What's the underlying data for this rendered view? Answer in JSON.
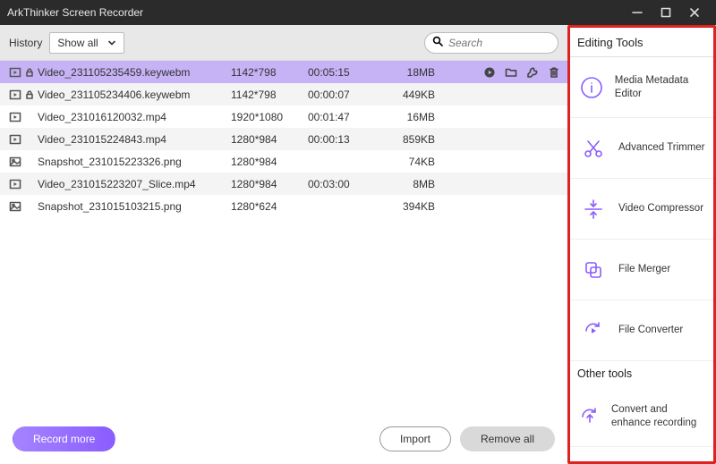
{
  "title": "ArkThinker Screen Recorder",
  "toolbar": {
    "history_label": "History",
    "filter_label": "Show all",
    "search_placeholder": "Search"
  },
  "files": [
    {
      "type": "video",
      "locked": true,
      "name": "Video_231105235459.keywebm",
      "resolution": "1142*798",
      "duration": "00:05:15",
      "size": "18MB",
      "selected": true
    },
    {
      "type": "video",
      "locked": true,
      "name": "Video_231105234406.keywebm",
      "resolution": "1142*798",
      "duration": "00:00:07",
      "size": "449KB",
      "selected": false
    },
    {
      "type": "video",
      "locked": false,
      "name": "Video_231016120032.mp4",
      "resolution": "1920*1080",
      "duration": "00:01:47",
      "size": "16MB",
      "selected": false
    },
    {
      "type": "video",
      "locked": false,
      "name": "Video_231015224843.mp4",
      "resolution": "1280*984",
      "duration": "00:00:13",
      "size": "859KB",
      "selected": false
    },
    {
      "type": "image",
      "locked": false,
      "name": "Snapshot_231015223326.png",
      "resolution": "1280*984",
      "duration": "",
      "size": "74KB",
      "selected": false
    },
    {
      "type": "video",
      "locked": false,
      "name": "Video_231015223207_Slice.mp4",
      "resolution": "1280*984",
      "duration": "00:03:00",
      "size": "8MB",
      "selected": false
    },
    {
      "type": "image",
      "locked": false,
      "name": "Snapshot_231015103215.png",
      "resolution": "1280*624",
      "duration": "",
      "size": "394KB",
      "selected": false
    }
  ],
  "footer": {
    "record_more": "Record more",
    "import": "Import",
    "remove_all": "Remove all"
  },
  "sidebar": {
    "editing_tools_label": "Editing Tools",
    "other_tools_label": "Other tools",
    "tools": [
      {
        "icon": "info",
        "label": "Media Metadata Editor"
      },
      {
        "icon": "scissors",
        "label": "Advanced Trimmer"
      },
      {
        "icon": "compress",
        "label": "Video Compressor"
      },
      {
        "icon": "merge",
        "label": "File Merger"
      },
      {
        "icon": "convert",
        "label": "File Converter"
      }
    ],
    "other": [
      {
        "icon": "enhance",
        "label": "Convert and enhance recording"
      }
    ]
  }
}
